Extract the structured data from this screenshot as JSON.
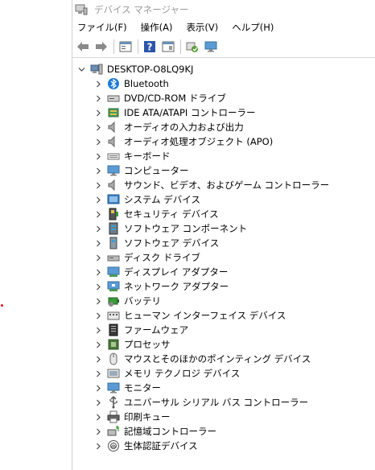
{
  "window": {
    "title": "デバイス マネージャー"
  },
  "menu": [
    "ファイル(F)",
    "操作(A)",
    "表示(V)",
    "ヘルプ(H)"
  ],
  "toolbar": [
    "back-icon",
    "forward-icon",
    "properties-icon",
    "help-icon",
    "view-icon",
    "scan-hardware-icon",
    "monitor-icon"
  ],
  "tree": {
    "root": "DESKTOP-O8LQ9KJ",
    "children": [
      {
        "label": "Bluetooth",
        "icon": "bluetooth-icon"
      },
      {
        "label": "DVD/CD-ROM ドライブ",
        "icon": "dvd-drive-icon"
      },
      {
        "label": "IDE ATA/ATAPI コントローラー",
        "icon": "ide-controller-icon"
      },
      {
        "label": "オーディオの入力および出力",
        "icon": "speaker-icon"
      },
      {
        "label": "オーディオ処理オブジェクト (APO)",
        "icon": "speaker-icon"
      },
      {
        "label": "キーボード",
        "icon": "keyboard-icon"
      },
      {
        "label": "コンピューター",
        "icon": "computer-icon"
      },
      {
        "label": "サウンド、ビデオ、およびゲーム コントローラー",
        "icon": "speaker-icon"
      },
      {
        "label": "システム デバイス",
        "icon": "system-device-icon"
      },
      {
        "label": "セキュリティ デバイス",
        "icon": "security-device-icon"
      },
      {
        "label": "ソフトウェア コンポーネント",
        "icon": "software-component-icon"
      },
      {
        "label": "ソフトウェア デバイス",
        "icon": "software-device-icon"
      },
      {
        "label": "ディスク ドライブ",
        "icon": "disk-drive-icon"
      },
      {
        "label": "ディスプレイ アダプター",
        "icon": "display-adapter-icon"
      },
      {
        "label": "ネットワーク アダプター",
        "icon": "network-adapter-icon"
      },
      {
        "label": "バッテリ",
        "icon": "battery-icon"
      },
      {
        "label": "ヒューマン インターフェイス デバイス",
        "icon": "hid-icon"
      },
      {
        "label": "ファームウェア",
        "icon": "firmware-icon"
      },
      {
        "label": "プロセッサ",
        "icon": "processor-icon"
      },
      {
        "label": "マウスとそのほかのポインティング デバイス",
        "icon": "mouse-icon"
      },
      {
        "label": "メモリ テクノロジ デバイス",
        "icon": "memory-icon"
      },
      {
        "label": "モニター",
        "icon": "monitor-icon"
      },
      {
        "label": "ユニバーサル シリアル バス コントローラー",
        "icon": "usb-icon"
      },
      {
        "label": "印刷キュー",
        "icon": "printer-icon"
      },
      {
        "label": "記憶域コントローラー",
        "icon": "storage-controller-icon"
      },
      {
        "label": "生体認証デバイス",
        "icon": "biometric-icon"
      }
    ]
  },
  "colors": {
    "accent": "#1e7ad6",
    "chevron": "#444444",
    "title": "#999999"
  }
}
